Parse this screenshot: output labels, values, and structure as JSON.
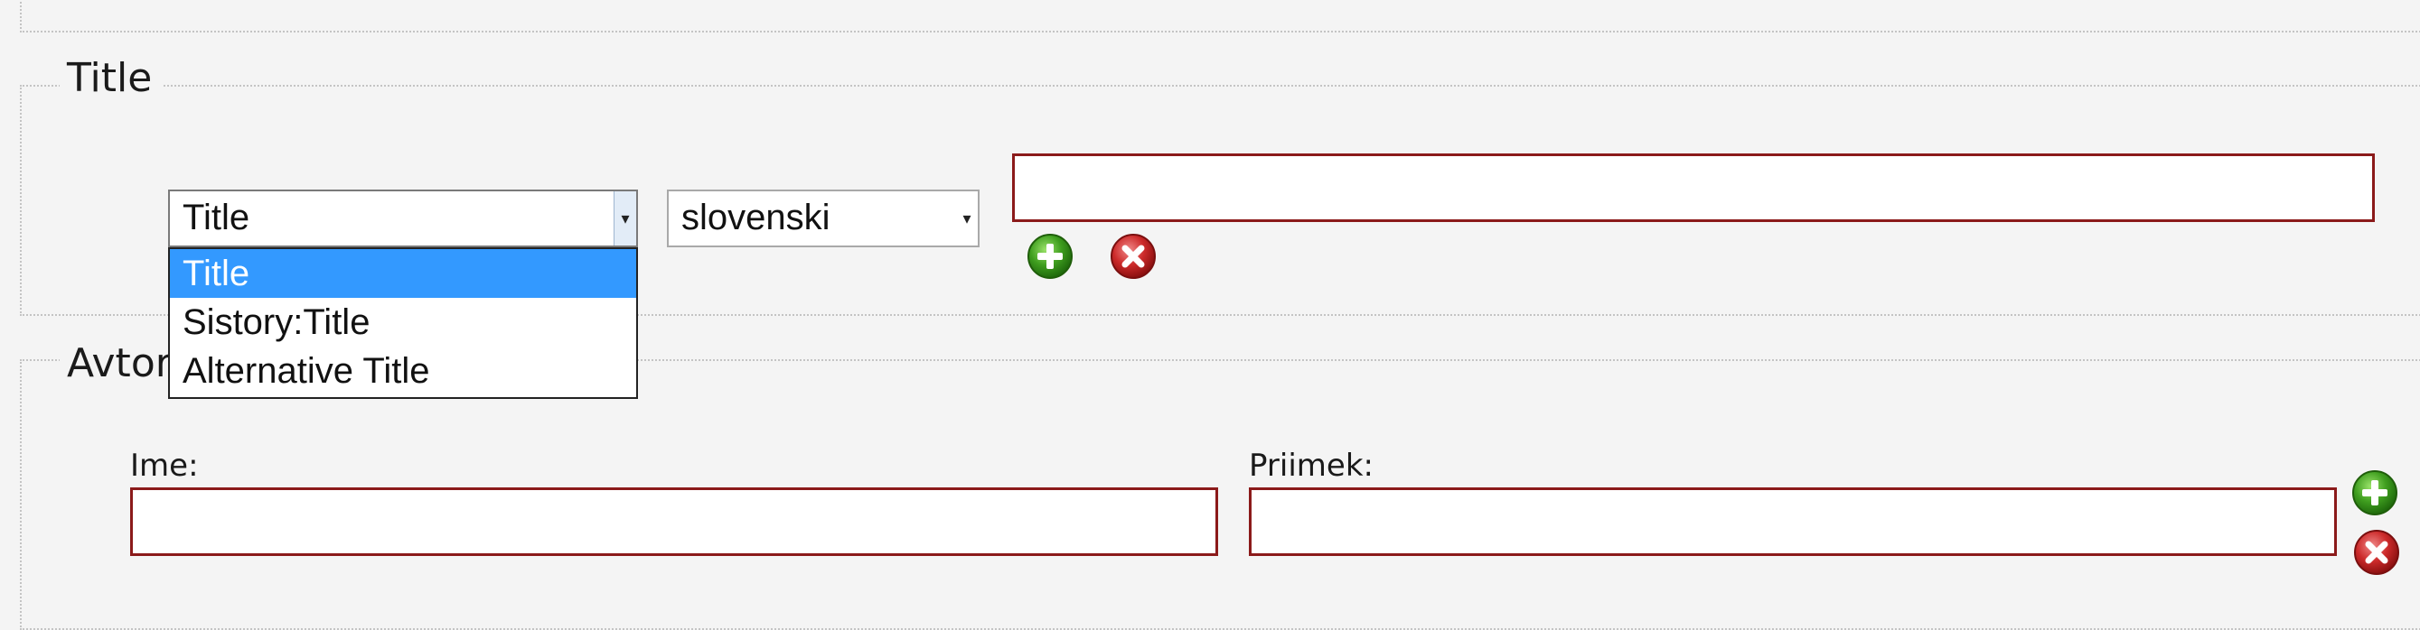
{
  "sections": {
    "title": {
      "legend": "Title",
      "type_select": {
        "value": "Title",
        "options": [
          "Title",
          "Sistory:Title",
          "Alternative Title"
        ],
        "selected_index": 0,
        "expanded": true
      },
      "language_select": {
        "value": "slovenski"
      },
      "title_input": {
        "value": ""
      },
      "icons": {
        "add": "plus-circle-icon",
        "remove": "x-circle-icon"
      }
    },
    "author": {
      "legend": "Avtor",
      "first_name_label": "Ime:",
      "last_name_label": "Priimek:",
      "first_name_value": "",
      "last_name_value": "",
      "icons": {
        "add": "plus-circle-icon",
        "remove": "x-circle-icon"
      }
    }
  },
  "colors": {
    "background": "#f4f4f4",
    "input_border": "#8b1a1a",
    "option_highlight": "#3399ff",
    "add_icon": "#3a9a1e",
    "remove_icon": "#c62828"
  }
}
